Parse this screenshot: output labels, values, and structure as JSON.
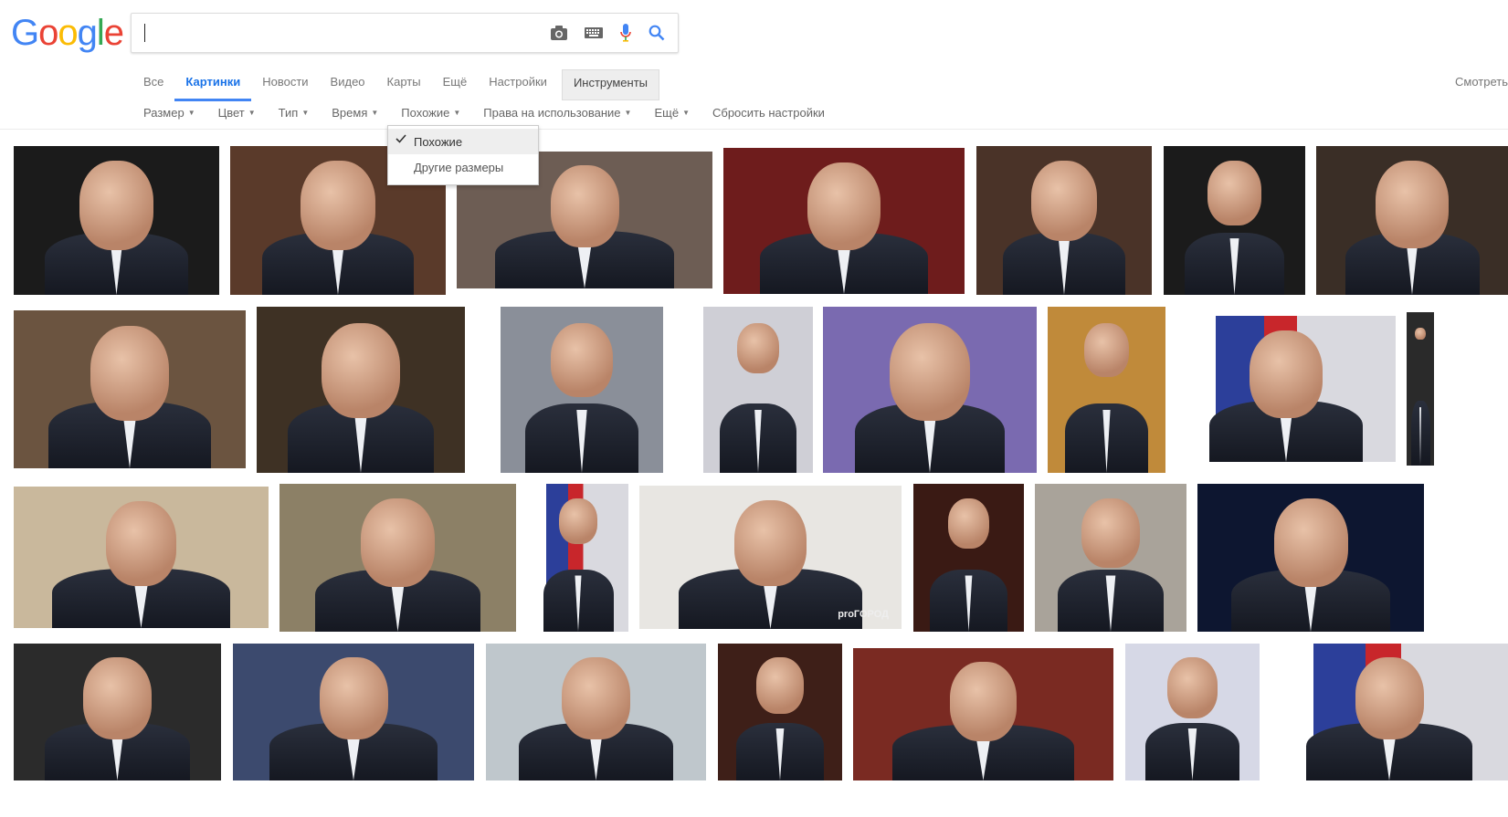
{
  "logo": {
    "letters": [
      "G",
      "o",
      "o",
      "g",
      "l",
      "e"
    ],
    "colors": [
      "#4285F4",
      "#EA4335",
      "#FBBC05",
      "#4285F4",
      "#34A853",
      "#EA4335"
    ]
  },
  "search": {
    "value": "",
    "placeholder": ""
  },
  "icons": [
    "camera-icon",
    "keyboard-icon",
    "microphone-icon",
    "search-icon"
  ],
  "tabs": [
    {
      "label": "Все"
    },
    {
      "label": "Картинки"
    },
    {
      "label": "Новости"
    },
    {
      "label": "Видео"
    },
    {
      "label": "Карты"
    },
    {
      "label": "Ещё"
    },
    {
      "label": "Настройки"
    },
    {
      "label": "Инструменты"
    }
  ],
  "watch_label": "Смотреть",
  "filters": [
    {
      "label": "Размер"
    },
    {
      "label": "Цвет"
    },
    {
      "label": "Тип"
    },
    {
      "label": "Время"
    },
    {
      "label": "Похожие"
    },
    {
      "label": "Права на использование"
    },
    {
      "label": "Ещё"
    },
    {
      "label": "Сбросить настройки"
    }
  ],
  "dropdown": {
    "items": [
      {
        "label": "Похожие",
        "selected": true
      },
      {
        "label": "Другие размеры",
        "selected": false
      }
    ]
  },
  "results": {
    "watermarks": [
      "proГОРОД"
    ],
    "colors": {
      "dark_bg": "#1b1b1b",
      "red_bg": "#6e1c1c",
      "flag_blue": "#2c3f9a",
      "flag_red": "#c8262b",
      "wall": "#cbb89a"
    }
  }
}
